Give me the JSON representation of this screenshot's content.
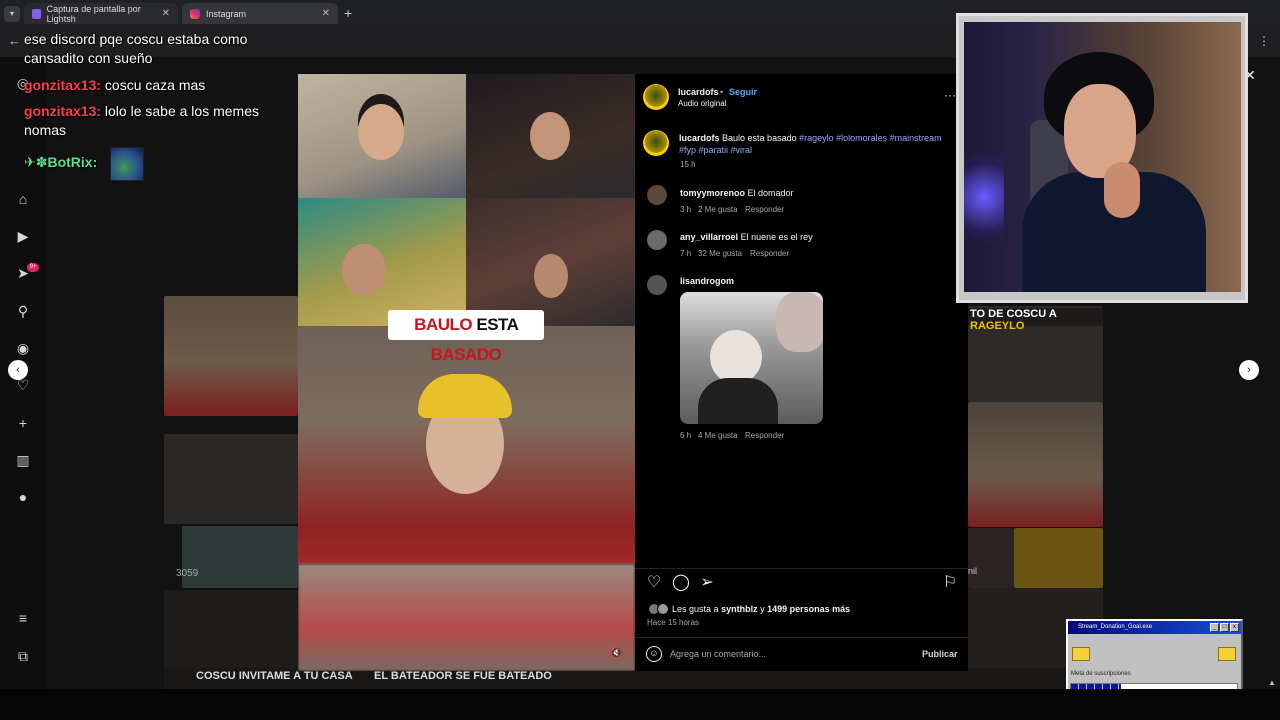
{
  "browser": {
    "tabs": [
      {
        "title": "Captura de pantalla por Lightsh",
        "close": "✕"
      },
      {
        "title": "Instagram",
        "close": "✕"
      }
    ],
    "new_tab": "+",
    "menu_icon": "chevron-down-icon",
    "back_icon": "←",
    "kebab_icon": "⋮"
  },
  "chat": {
    "messages": [
      {
        "user": "",
        "text": "ese discord pqe coscu estaba como cansadito con sueño"
      },
      {
        "user": "gonzitax13:",
        "text": "coscu caza mas"
      },
      {
        "user": "gonzitax13:",
        "text": "lolo le sabe a los memes nomas"
      },
      {
        "user": "BotRix:",
        "text": "",
        "badges": "✈✽"
      }
    ]
  },
  "ig_rail": {
    "icons": [
      "instagram-logo-icon",
      "home-icon",
      "reels-icon",
      "send-icon",
      "search-icon",
      "explore-icon",
      "heart-icon",
      "create-icon",
      "dashboard-icon",
      "profile-icon",
      "menu-icon",
      "threads-icon"
    ],
    "notification_badge": "9+"
  },
  "video": {
    "caption_red_1": "BAULO",
    "caption_black": "ESTA",
    "caption_red_2": "BASADO",
    "mute_icon": "🔇"
  },
  "side_collage": {
    "right_caption_white": "TO DE COSCU A",
    "right_caption_yellow": "RAGEYLO",
    "left_views": "3059",
    "strip_captions": [
      "COSCU INVITAME A TU CASA",
      "EL BATEADOR SE FUE BATEADO"
    ],
    "right_edge_text": "nil"
  },
  "post": {
    "author": "lucardofs",
    "separator": "•",
    "follow": "Seguir",
    "audio": "Audio original",
    "more": "···",
    "caption_author": "lucardofs",
    "caption_text": "Baulo esta basado",
    "hashtags_line1": "#rageylo #lolomorales #mainstream",
    "hashtags_line2": "#fyp #paratii #viral",
    "caption_time": "15 h",
    "comments": [
      {
        "user": "tomyymorenoo",
        "text": "El domador",
        "time": "3 h",
        "likes": "2 Me gusta",
        "reply": "Responder"
      },
      {
        "user": "any_villarroel",
        "text": "El nuene es el rey",
        "time": "7 h",
        "likes": "32 Me gusta",
        "reply": "Responder"
      },
      {
        "user": "lisandrogom",
        "text": "",
        "time": "6 h",
        "likes": "4 Me gusta",
        "reply": "Responder"
      }
    ],
    "likes_text_prefix": "Les gusta a",
    "likes_user": "synthblz",
    "likes_text_mid": "y",
    "likes_count": "1499 personas más",
    "posted": "Hace 15 horas",
    "comment_placeholder": "Agrega un comentario...",
    "publish": "Publicar"
  },
  "nav": {
    "prev": "‹",
    "next": "›",
    "close": "✕"
  },
  "goal_widget": {
    "title": "Stream_Donation_Goal.exe",
    "label": "Meta de suscripciones",
    "progress": 0.3,
    "buttons": [
      "_",
      "□",
      "x"
    ]
  }
}
